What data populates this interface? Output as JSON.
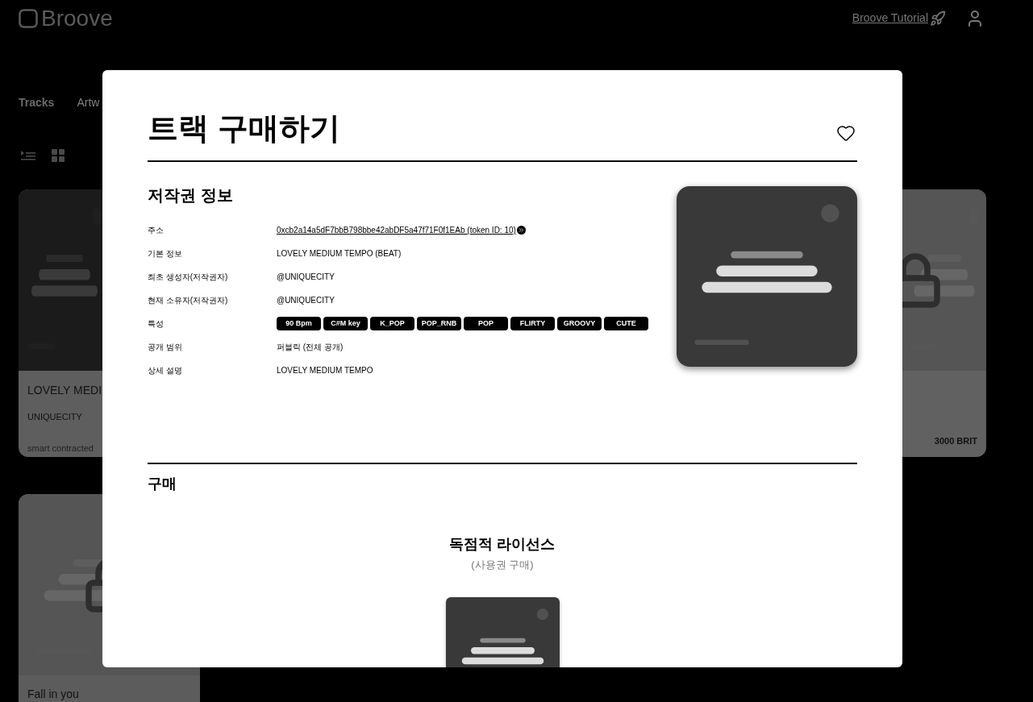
{
  "header": {
    "logo": "Broove",
    "tutorial_link": "Broove Tutorial"
  },
  "tabs": [
    {
      "label": "Tracks",
      "selected": true
    },
    {
      "label": "Artw",
      "selected": false
    }
  ],
  "view_modes": [
    {
      "kind": "list"
    },
    {
      "kind": "grid"
    }
  ],
  "first_row_cards": [
    {
      "title": "LOVELY MEDI",
      "artist": "UNIQUECITY",
      "footer": "smart contracted",
      "locked": false
    },
    {
      "price": "3000 BRIT",
      "locked": true
    }
  ],
  "second_row_cards": [
    {
      "title": "Fall in you",
      "locked": true
    }
  ],
  "modal": {
    "title": "트랙 구매하기",
    "favorite": false,
    "copyright_section": {
      "title": "저작권 정보",
      "rows": [
        {
          "kind": "link",
          "label": "주소",
          "value": "0xcb2a14a5dF7bbB798bbe42abDF5a47f71F0f1EAb (token ID: 10)"
        },
        {
          "kind": "text",
          "label": "기본 정보",
          "value": "LOVELY MEDIUM TEMPO (BEAT)"
        },
        {
          "kind": "text",
          "label": "최초 생성자(저작권자)",
          "value": "@UNIQUECITY"
        },
        {
          "kind": "text",
          "label": "현재 소유자(저작권자)",
          "value": "@UNIQUECITY"
        },
        {
          "kind": "tags",
          "label": "특성",
          "tags": [
            "90 Bpm",
            "C#M key",
            "K_POP",
            "POP_RNB",
            "POP",
            "FLIRTY",
            "GROOVY",
            "CUTE"
          ]
        },
        {
          "kind": "text",
          "label": "공개 범위",
          "value": "퍼블릭 (전체 공개)"
        },
        {
          "kind": "text",
          "label": "상세 설명",
          "value": "LOVELY MEDIUM TEMPO"
        }
      ]
    },
    "purchase_section": {
      "title": "구매",
      "license_title": "독점적 라이선스",
      "license_subtitle": "(사용권 구매)"
    }
  }
}
